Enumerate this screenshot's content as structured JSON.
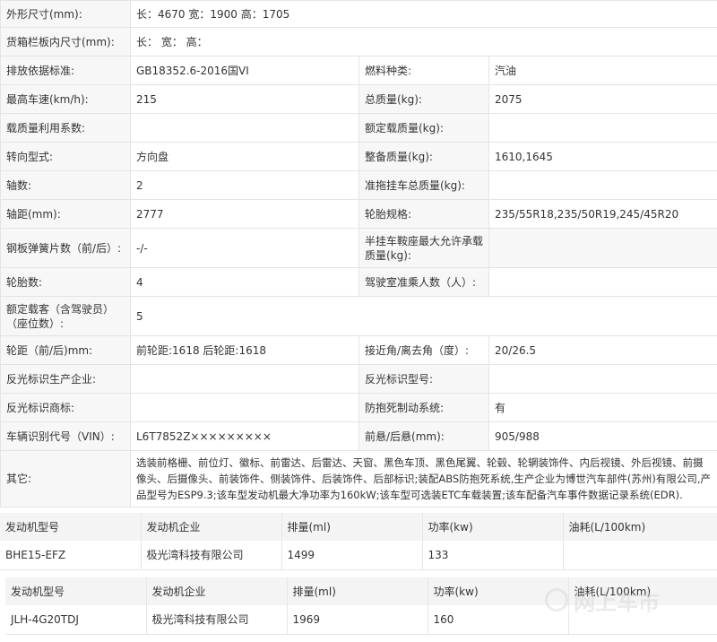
{
  "spec": {
    "dimensions_label": "外形尺寸(mm):",
    "dimensions_value": "长：4670 宽：1900 高：1705",
    "cargo_label": "货箱栏板内尺寸(mm):",
    "cargo_value": "长：  宽：  高：",
    "emission_label": "排放依据标准:",
    "emission_value": "GB18352.6-2016国VI",
    "fuel_label": "燃料种类:",
    "fuel_value": "汽油",
    "speed_label": "最高车速(km/h):",
    "speed_value": "215",
    "total_mass_label": "总质量(kg):",
    "total_mass_value": "2075",
    "load_util_label": "载质量利用系数:",
    "load_util_value": "",
    "rated_load_label": "额定载质量(kg):",
    "rated_load_value": "",
    "steering_label": "转向型式:",
    "steering_value": "方向盘",
    "curb_mass_label": "整备质量(kg):",
    "curb_mass_value": "1610,1645",
    "axles_label": "轴数:",
    "axles_value": "2",
    "trailer_mass_label": "准拖挂车总质量(kg):",
    "trailer_mass_value": "",
    "wheelbase_label": "轴距(mm):",
    "wheelbase_value": "2777",
    "tire_label": "轮胎规格:",
    "tire_value": "235/55R18,235/50R19,245/45R20",
    "spring_label": "钢板弹簧片数（前/后）:",
    "spring_value": "-/-",
    "saddle_label": "半挂车鞍座最大允许承载质量(kg):",
    "saddle_value": "",
    "tire_count_label": "轮胎数:",
    "tire_count_value": "4",
    "cab_label": "驾驶室准乘人数（人）:",
    "cab_value": "",
    "passengers_label": "额定载客（含驾驶员）（座位数）:",
    "passengers_value": "5",
    "track_label": "轮距（前/后)mm:",
    "track_value": "前轮距:1618 后轮距:1618",
    "angle_label": "接近角/离去角（度）:",
    "angle_value": "20/26.5",
    "reflect_maker_label": "反光标识生产企业:",
    "reflect_maker_value": "",
    "reflect_model_label": "反光标识型号:",
    "reflect_model_value": "",
    "reflect_brand_label": "反光标识商标:",
    "reflect_brand_value": "",
    "abs_label": "防抱死制动系统:",
    "abs_value": "有",
    "vin_label": "车辆识别代号（VIN）:",
    "vin_value": "L6T7852Z×××××××××",
    "overhang_label": "前悬/后悬(mm):",
    "overhang_value": "905/988",
    "other_label": "其它:",
    "other_value": "选装前格栅、前位灯、徽标、前雷达、后雷达、天窗、黑色车顶、黑色尾翼、轮毂、轮辋装饰件、内后视镜、外后视镜、前摄像头、后摄像头、前装饰件、侧装饰件、后装饰件、后部标识;装配ABS防抱死系统,生产企业为博世汽车部件(苏州)有限公司,产品型号为ESP9.3;该车型发动机最大净功率为160kW;该车型可选装ETC车载装置;该车配备汽车事件数据记录系统(EDR)."
  },
  "engine1": {
    "headers": [
      "发动机型号",
      "发动机企业",
      "排量(ml)",
      "功率(kw)",
      "油耗(L/100km)"
    ],
    "row": [
      "BHE15-EFZ",
      "极光湾科技有限公司",
      "1499",
      "133",
      ""
    ]
  },
  "engine2": {
    "headers": [
      "发动机型号",
      "发动机企业",
      "排量(ml)",
      "功率(kw)",
      "油耗(L/100km)"
    ],
    "row": [
      "JLH-4G20TDJ",
      "极光湾科技有限公司",
      "1969",
      "160",
      ""
    ]
  },
  "watermark": {
    "text": "网上车市",
    "icon": "wangshang-logo-icon",
    "color": "#c8c8c8"
  },
  "colors": {
    "label_bg": "#f7f7f7",
    "border": "#e4e4e4",
    "header_bg": "#f4f4f4"
  }
}
